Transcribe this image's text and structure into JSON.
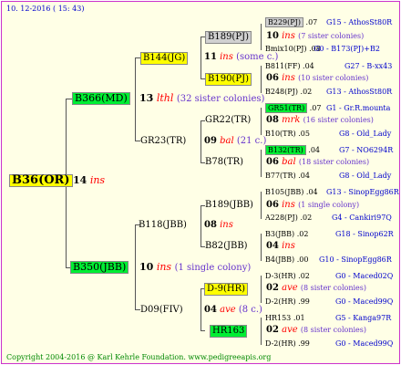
{
  "header": "10. 12-2016 ( 15: 43)",
  "footer": "Copyright 2004-2016 @ Karl Kehrle Foundation.   www.pedigreeapis.org",
  "root": {
    "id": "B36(OR)",
    "year": "14",
    "sister": "ins"
  },
  "gen1": [
    {
      "id": "B366(MD)",
      "year": "13",
      "sister": "lthl",
      "note": "(32 sister colonies)"
    },
    {
      "id": "B350(JBB)",
      "year": "10",
      "sister": "ins",
      "note": "(1 single colony)"
    }
  ],
  "gen2": [
    {
      "id": "B144(JG)",
      "year": "11",
      "sister": "ins",
      "note": "(some c.)"
    },
    {
      "id": "GR23(TR)",
      "year": "09",
      "sister": "bal",
      "note": "(21 c.)"
    },
    {
      "id": "B118(JBB)",
      "year": "08",
      "sister": "ins",
      "note": ""
    },
    {
      "id": "D09(FIV)",
      "year": "04",
      "sister": "ave",
      "note": "(8 c.)"
    }
  ],
  "gen3": [
    {
      "id": "B189(PJ)",
      "year": "10",
      "sister": "ins",
      "note": "(7 sister colonies)"
    },
    {
      "id": "B190(PJ)",
      "year": "06",
      "sister": "ins",
      "note": "(10 sister colonies)"
    },
    {
      "id": "GR22(TR)",
      "year": "08",
      "sister": "mrk",
      "note": "(16 sister colonies)"
    },
    {
      "id": "B78(TR)",
      "year": "06",
      "sister": "bal",
      "note": "(18 sister colonies)"
    },
    {
      "id": "B189(JBB)",
      "year": "06",
      "sister": "ins",
      "note": "(1 single colony)"
    },
    {
      "id": "B82(JBB)",
      "year": "04",
      "sister": "ins",
      "note": ""
    },
    {
      "id": "D-9(HR)",
      "year": "02",
      "sister": "ave",
      "note": "(8 sister colonies)"
    },
    {
      "id": "HR163",
      "year": "02",
      "sister": "ave",
      "note": "(8 sister colonies)"
    }
  ],
  "gen4": [
    {
      "id": "B229(PJ)",
      "val": ".07",
      "right": "G15 - AthosSt80R"
    },
    {
      "id": "Bmix10(PJ)",
      "val": ".08",
      "right": "G0 - B173(PJ)+B2"
    },
    {
      "id": "B811(FF)",
      "val": ".04",
      "right": "G27 - B-xx43"
    },
    {
      "id": "B248(PJ)",
      "val": ".02",
      "right": "G13 - AthosSt80R"
    },
    {
      "id": "GR51(TR)",
      "val": ".07",
      "right": "G1 - Gr.R.mounta"
    },
    {
      "id": "B10(TR)",
      "val": ".05",
      "right": "G8 - Old_Lady"
    },
    {
      "id": "B132(TR)",
      "val": ".04",
      "right": "G7 - NO6294R"
    },
    {
      "id": "B77(TR)",
      "val": ".04",
      "right": "G8 - Old_Lady"
    },
    {
      "id": "B105(JBB)",
      "val": ".04",
      "right": "G13 - SinopEgg86R"
    },
    {
      "id": "A228(PJ)",
      "val": ".02",
      "right": "G4 - Cankiri97Q"
    },
    {
      "id": "B3(JBB)",
      "val": ".02",
      "right": "G18 - Sinop62R"
    },
    {
      "id": "B4(JBB)",
      "val": ".00",
      "right": "G10 - SinopEgg86R"
    },
    {
      "id": "D-3(HR)",
      "val": ".02",
      "right": "G0 - Maced02Q"
    },
    {
      "id": "D-2(HR)",
      "val": ".99",
      "right": "G0 - Maced99Q"
    },
    {
      "id": "HR153",
      "val": ".01",
      "right": "G5 - Kanga97R"
    },
    {
      "id": "D-2(HR)",
      "val": ".99",
      "right": "G0 - Maced99Q"
    }
  ]
}
